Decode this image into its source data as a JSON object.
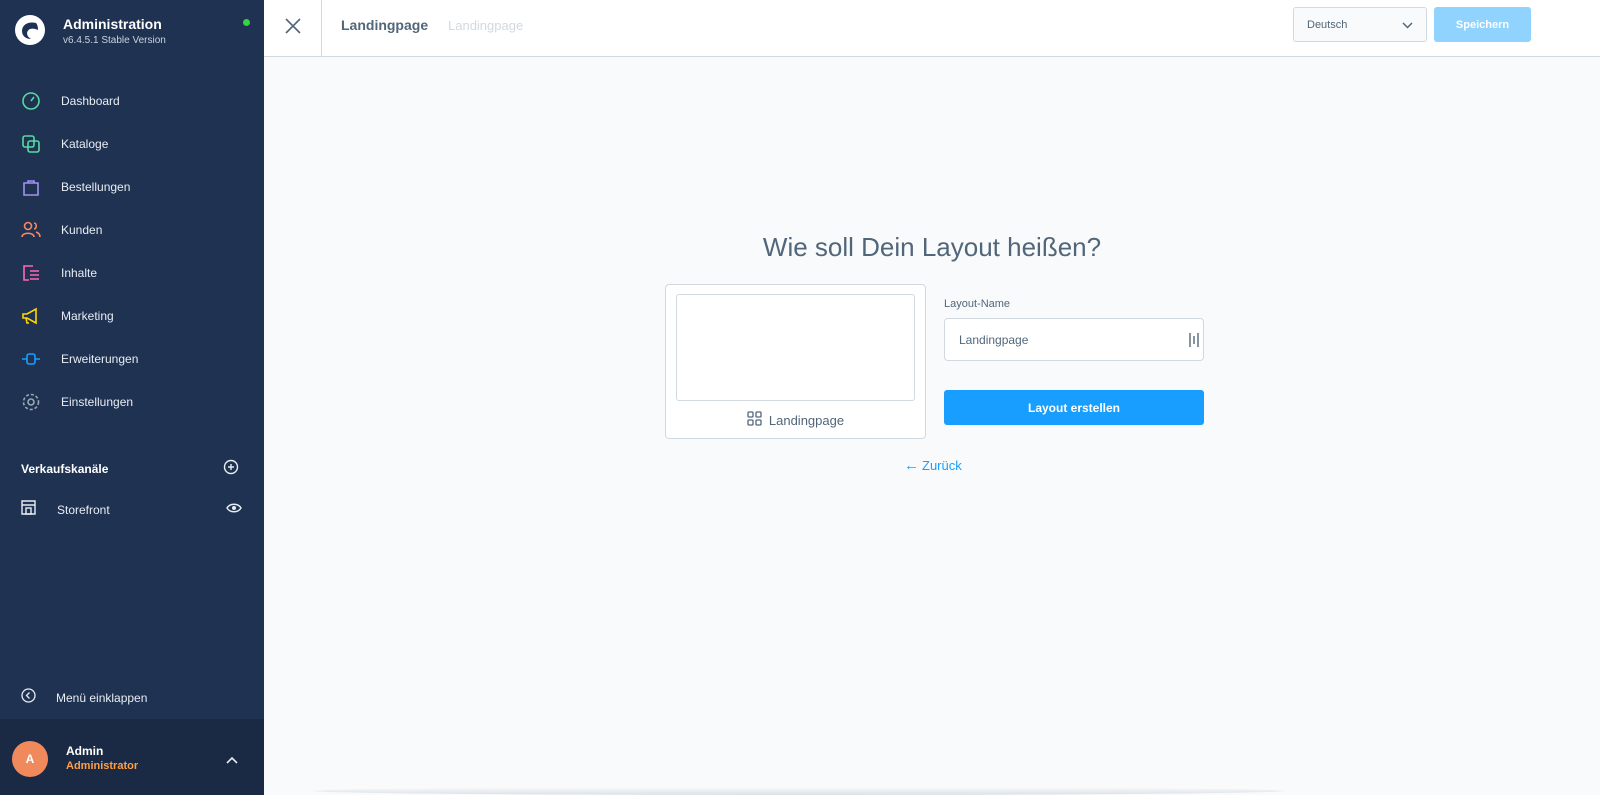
{
  "sidebar": {
    "brand": {
      "title": "Administration",
      "version": "v6.4.5.1 Stable Version"
    },
    "items": [
      {
        "label": "Dashboard",
        "icon": "gauge-icon",
        "color": "#57d9a3"
      },
      {
        "label": "Kataloge",
        "icon": "catalog-icon",
        "color": "#57d9a3"
      },
      {
        "label": "Bestellungen",
        "icon": "shopping-bag-icon",
        "color": "#a092f0"
      },
      {
        "label": "Kunden",
        "icon": "users-icon",
        "color": "#f88962"
      },
      {
        "label": "Inhalte",
        "icon": "content-icon",
        "color": "#ff68b4"
      },
      {
        "label": "Marketing",
        "icon": "megaphone-icon",
        "color": "#ffd700"
      },
      {
        "label": "Erweiterungen",
        "icon": "plug-icon",
        "color": "#189eff"
      },
      {
        "label": "Einstellungen",
        "icon": "gear-icon",
        "color": "#9aa8b5"
      }
    ],
    "sales_channels": {
      "title": "Verkaufskanäle",
      "items": [
        {
          "label": "Storefront"
        }
      ]
    },
    "collapse_label": "Menü einklappen",
    "user": {
      "initial": "A",
      "name": "Admin",
      "role": "Administrator"
    }
  },
  "topbar": {
    "title": "Landingpage",
    "subtitle": "Landingpage",
    "language": "Deutsch",
    "save_label": "Speichern"
  },
  "main": {
    "heading": "Wie soll Dein Layout heißen?",
    "preview_label": "Landingpage",
    "field_label": "Layout-Name",
    "field_value": "Landingpage",
    "create_label": "Layout erstellen",
    "back_label": "Zurück"
  },
  "colors": {
    "sidebar_bg": "#1f3251",
    "primary": "#189eff",
    "save_disabled": "#8fd3fe"
  }
}
